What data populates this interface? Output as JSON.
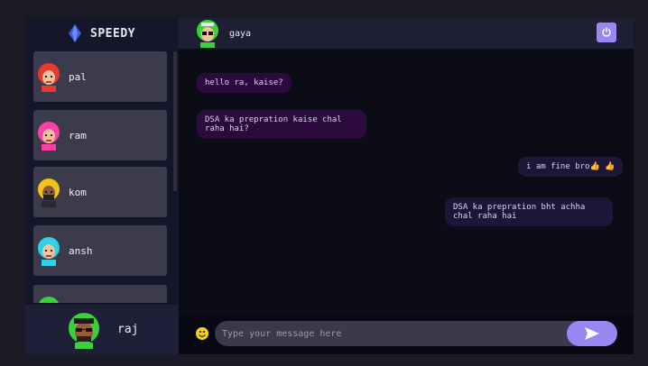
{
  "brand": {
    "name": "SPEEDY",
    "logo_icon": "diamond-logo-icon"
  },
  "contacts": [
    {
      "name": "pal",
      "avatar": "avatar-red"
    },
    {
      "name": "ram",
      "avatar": "avatar-pink"
    },
    {
      "name": "kom",
      "avatar": "avatar-yellow"
    },
    {
      "name": "ansh",
      "avatar": "avatar-cyan"
    },
    {
      "name": "",
      "avatar": "avatar-green"
    }
  ],
  "current_user": {
    "name": "raj",
    "avatar": "avatar-green"
  },
  "chat": {
    "contact_name": "gaya",
    "logout_icon": "logout-icon",
    "messages": [
      {
        "direction": "received",
        "text": "hello ra, kaise?"
      },
      {
        "direction": "received",
        "text": "DSA ka prepration kaise chal raha hai?"
      },
      {
        "direction": "sent",
        "text": "i am fine bro👍 👍"
      },
      {
        "direction": "sent",
        "text": "DSA ka prepration bht achha chal raha hai"
      }
    ]
  },
  "input": {
    "placeholder": "Type your message here",
    "value": "",
    "emoji_icon": "emoji-icon",
    "send_icon": "send-icon"
  },
  "colors": {
    "accent": "#9a86f3",
    "sidebar_bg": "#16162a",
    "chat_bg": "#0c0c17",
    "contact_bg": "#3b3b4b",
    "received_bubble": "#2b0a3d",
    "sent_bubble": "#1d1638"
  }
}
